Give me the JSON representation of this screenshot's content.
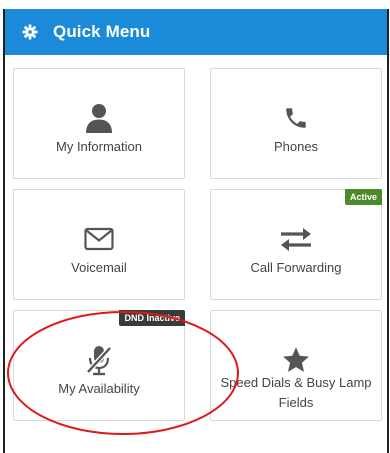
{
  "header": {
    "title": "Quick Menu",
    "icon": "gear-icon"
  },
  "tiles": [
    {
      "label": "My Information",
      "icon": "user-icon"
    },
    {
      "label": "Phones",
      "icon": "phone-icon"
    },
    {
      "label": "Voicemail",
      "icon": "envelope-icon"
    },
    {
      "label": "Call Forwarding",
      "icon": "arrows-exchange-icon",
      "badge": "Active"
    },
    {
      "label": "My Availability",
      "icon": "microphone-slash-icon",
      "badge": "DND Inactive"
    },
    {
      "label": "Speed Dials & Busy Lamp Fields",
      "icon": "star-icon"
    }
  ],
  "colors": {
    "header": "#1b8bd9",
    "badge_active": "#4a8a2a",
    "badge_dnd": "#3a3a3a",
    "annotation": "#e01818"
  }
}
